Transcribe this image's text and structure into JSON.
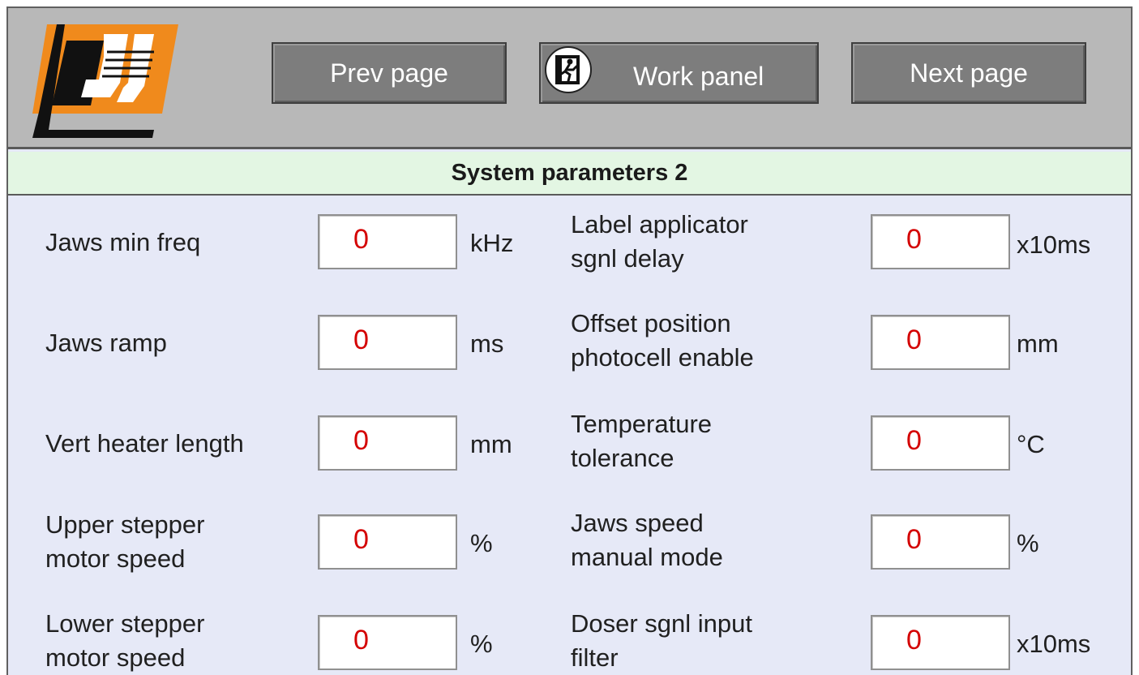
{
  "header": {
    "logo_alt": "U",
    "prev_label": "Prev page",
    "work_label": "Work panel",
    "next_label": "Next page",
    "work_icon": "emergency-exit-icon"
  },
  "page_title": "System parameters 2",
  "colors": {
    "header_bg": "#b8b8b8",
    "button_bg": "#7d7d7d",
    "title_bar_bg": "#e3f6e3",
    "panel_bg": "#e6e9f7",
    "value_text": "#d40000",
    "logo_orange": "#f08a1c"
  },
  "params": {
    "left": [
      {
        "label": "Jaws min freq",
        "value": "0",
        "unit": "kHz"
      },
      {
        "label": "Jaws ramp",
        "value": "0",
        "unit": "ms"
      },
      {
        "label": "Vert heater length",
        "value": "0",
        "unit": "mm"
      },
      {
        "label": "Upper stepper\nmotor speed",
        "value": "0",
        "unit": "%"
      },
      {
        "label": "Lower stepper\nmotor speed",
        "value": "0",
        "unit": "%"
      }
    ],
    "right": [
      {
        "label": "Label applicator\nsgnl delay",
        "value": "0",
        "unit": "x10ms"
      },
      {
        "label": "Offset position\nphotocell enable",
        "value": "0",
        "unit": "mm"
      },
      {
        "label": "Temperature\ntolerance",
        "value": "0",
        "unit": "°C"
      },
      {
        "label": "Jaws speed\nmanual mode",
        "value": "0",
        "unit": "%"
      },
      {
        "label": "Doser sgnl input\nfilter",
        "value": "0",
        "unit": "x10ms"
      }
    ]
  }
}
